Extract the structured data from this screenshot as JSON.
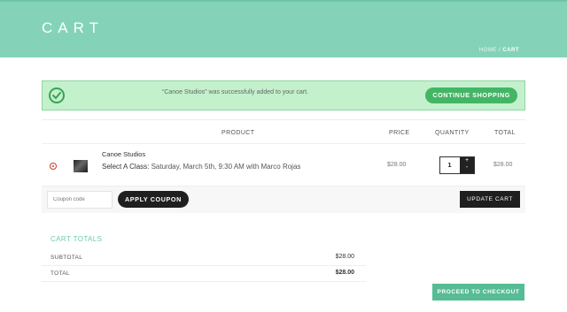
{
  "header": {
    "title": "CART",
    "breadcrumb": {
      "home": "HOME",
      "separator": "/",
      "current": "CART"
    }
  },
  "notice": {
    "message": "“Canoe Studios” was successfully added to your cart.",
    "button": "CONTINUE SHOPPING"
  },
  "cart_table": {
    "columns": [
      "PRODUCT",
      "PRICE",
      "QUANTITY",
      "TOTAL"
    ],
    "items": [
      {
        "name": "Canoe Studios",
        "class_label": "Select A Class:",
        "class_value": "Saturday, March 5th, 9:30 AM with Marco Rojas",
        "price": "$28.00",
        "quantity": "1",
        "step_up": "+",
        "step_down": "-",
        "total": "$28.00"
      }
    ]
  },
  "actions": {
    "coupon_placeholder": "Coupon code",
    "apply_coupon": "APPLY COUPON",
    "update_cart": "UPDATE CART"
  },
  "totals": {
    "title": "CART TOTALS",
    "subtotal_label": "SUBTOTAL",
    "subtotal": "$28.00",
    "total_label": "TOTAL",
    "total": "$28.00",
    "checkout": "PROCEED TO CHECKOUT"
  },
  "colors": {
    "header_bg": "#84d3b8",
    "notice_bg": "#c2f1cc",
    "success_button": "#44b565",
    "checkout_button": "#57bc95",
    "remove_icon": "#cc3a2a"
  }
}
